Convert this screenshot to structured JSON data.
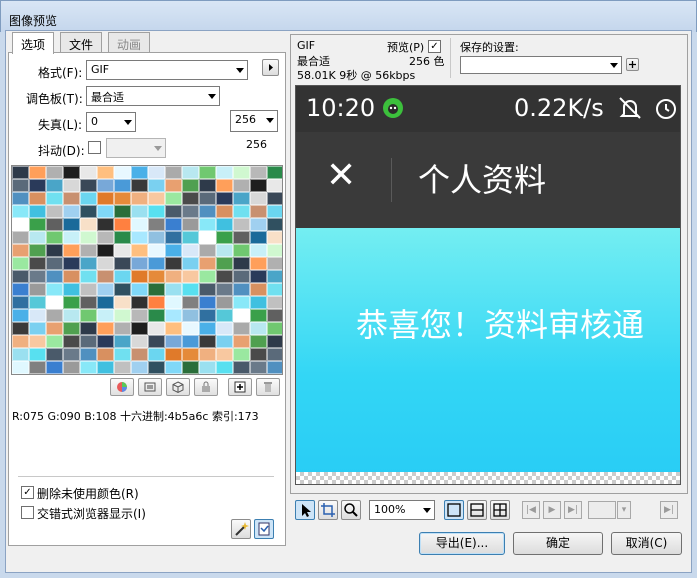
{
  "window": {
    "title": "图像预览"
  },
  "tabs": [
    {
      "label": "选项",
      "state": "active"
    },
    {
      "label": "文件",
      "state": "normal"
    },
    {
      "label": "动画",
      "state": "disabled"
    }
  ],
  "options": {
    "format_label": "格式(F):",
    "format_value": "GIF",
    "palette_label": "调色板(T):",
    "palette_value": "最合适",
    "loss_label": "失真(L):",
    "loss_value": "0",
    "dither_label": "抖动(D):",
    "colors_value": "256",
    "colors_count": "256"
  },
  "palette_colors": [
    "#2e3a4a",
    "#4aa5c8",
    "#6bd6f0",
    "#2a6e3a",
    "#808080",
    "#55c8d8",
    "#b8e8f0",
    "#ff9f5a",
    "#d8d8d8",
    "#e07a2a",
    "#9ae0f0",
    "#3a7fd0",
    "#ffffff",
    "#70c870",
    "#b0b0b0",
    "#3a4858",
    "#e58a3a",
    "#58e0f0",
    "#9a9a9a",
    "#3aa04a",
    "#c8f0f8",
    "#1e1e1e",
    "#78a8d8",
    "#f0b080",
    "#4a5a6a",
    "#88e8f8",
    "#606060",
    "#d0f8d0",
    "#e8e8e8",
    "#4a9ad8",
    "#f8c8a0",
    "#6a7a8a",
    "#40c0e0",
    "#1a6a9a",
    "#b8b8b8",
    "#ffbf7f",
    "#3a3a3a",
    "#9ae8a0",
    "#5090c0",
    "#c0c0c0",
    "#f8e0c8",
    "#2a8a4a",
    "#e8f8ff",
    "#7ad0f0",
    "#4a4a4a",
    "#d89060",
    "#a0d0f0",
    "#303030",
    "#a8e8ff",
    "#4ab0e8",
    "#e8a070",
    "#5a6a7a",
    "#70e0f0",
    "#305060",
    "#ff8040",
    "#90c0e0",
    "#d8e8f8",
    "#50a050",
    "#2a3a5a",
    "#c89070",
    "#80d8f8",
    "#e0f8ff",
    "#3070a0",
    "#aaaaaa"
  ],
  "color_info": "R:075 G:090 B:108 十六进制:4b5a6c 索引:173",
  "checks": [
    {
      "label": "删除未使用颜色(R)",
      "checked": true
    },
    {
      "label": "交错式浏览器显示(I)",
      "checked": false
    }
  ],
  "preview_info": {
    "format": "GIF",
    "palette": "最合适",
    "size_time": "58.01K 9秒 @ 56kbps",
    "preview_label": "预览(P)",
    "colors": "256 色",
    "saved_settings_label": "保存的设置:",
    "saved_settings_value": ""
  },
  "preview_image": {
    "time": "10:20",
    "speed": "0.22K/s",
    "close": "✕",
    "page_title": "个人资料",
    "message": "恭喜您！资料审核通"
  },
  "zoom": "100%",
  "buttons": {
    "export": "导出(E)...",
    "ok": "确定",
    "cancel": "取消(C)"
  },
  "colors": {
    "accent": "#3c7fb1",
    "statusbar": "#333333",
    "appbar": "#3a3a3a",
    "content_top": "#74eef2",
    "content_bottom": "#29cdf5"
  }
}
